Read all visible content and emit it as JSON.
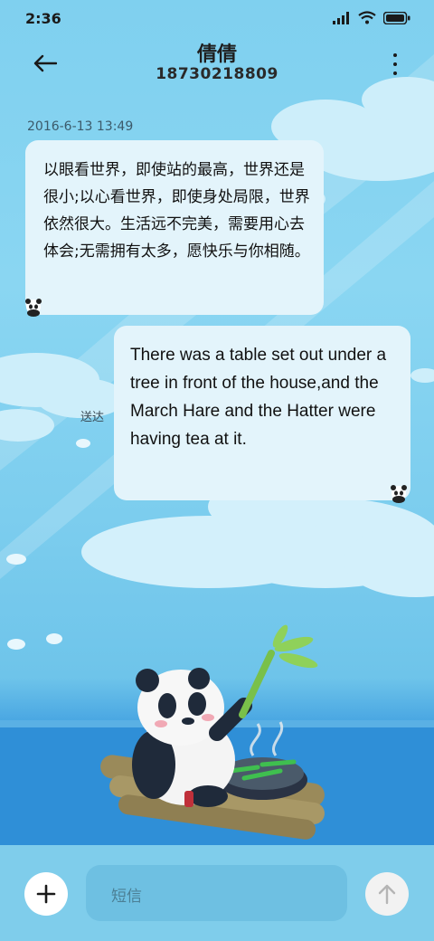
{
  "status_bar": {
    "time": "2:36"
  },
  "header": {
    "contact_name": "倩倩",
    "phone_number": "18730218809"
  },
  "conversation": {
    "timestamp": "2016-6-13 13:49",
    "messages": [
      {
        "direction": "incoming",
        "text": "以眼看世界，即使站的最高，世界还是很小;以心看世界，即使身处局限，世界依然很大。生活远不完美，需要用心去体会;无需拥有太多，愿快乐与你相随。"
      },
      {
        "direction": "outgoing",
        "text": "There was a table set out under a tree in front of the house,and the March Hare and the Hatter were having tea at it.",
        "status": "送达"
      }
    ]
  },
  "compose": {
    "placeholder": "短信"
  },
  "icons": {
    "back": "back-arrow-icon",
    "more": "more-vertical-icon",
    "add": "plus-icon",
    "send": "send-arrow-icon",
    "signal": "signal-icon",
    "wifi": "wifi-icon",
    "battery": "battery-icon"
  },
  "colors": {
    "bubble": "#e3f4fb",
    "background_sky": "#7fd0ef",
    "background_sea": "#2e8fd6",
    "compose_bar": "#7fcdeb"
  }
}
